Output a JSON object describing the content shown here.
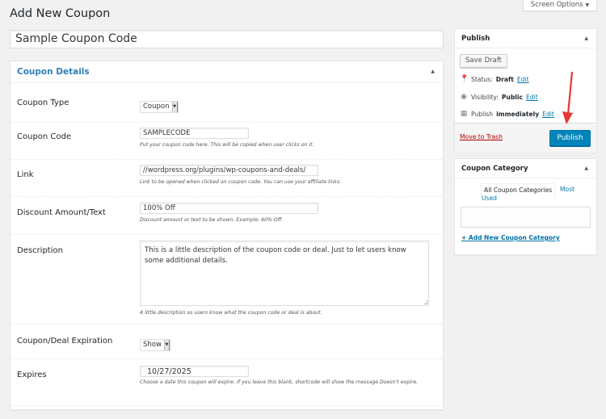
{
  "header": {
    "screen_options_label": "Screen Options",
    "page_title": "Add New Coupon"
  },
  "title_field": {
    "value": "Sample Coupon Code"
  },
  "coupon_details": {
    "title": "Coupon Details",
    "fields": {
      "coupon_type": {
        "label": "Coupon Type",
        "value": "Coupon"
      },
      "coupon_code": {
        "label": "Coupon Code",
        "value": "SAMPLECODE",
        "hint": "Put your coupon code here. This will be copied when user clicks on it."
      },
      "link": {
        "label": "Link",
        "value": "//wordpress.org/plugins/wp-coupons-and-deals/",
        "hint": "Link to be opened when clicked on coupon code. You can use your affiliate links."
      },
      "discount": {
        "label": "Discount Amount/Text",
        "value": "100% Off",
        "hint": "Discount amount or text to be shown. Example: 60% Off."
      },
      "description": {
        "label": "Description",
        "value": "This is a little description of the coupon code or deal. Just to let users know some additional details.",
        "hint": "A little description so users know what the coupon code or deal is about."
      },
      "expiration": {
        "label": "Coupon/Deal Expiration",
        "value": "Show"
      },
      "expires": {
        "label": "Expires",
        "value": "10/27/2025",
        "hint": "Choose a date this coupon will expire. If you leave this blank, shortcode will show the message Doesn't expire."
      }
    }
  },
  "publish": {
    "title": "Publish",
    "save_draft_label": "Save Draft",
    "status_label": "Status:",
    "status_value": "Draft",
    "visibility_label": "Visibility:",
    "visibility_value": "Public",
    "schedule_label": "Publish",
    "schedule_value": "immediately",
    "edit_label": "Edit",
    "trash_label": "Move to Trash",
    "publish_label": "Publish"
  },
  "category": {
    "title": "Coupon Category",
    "tab_all": "All Coupon Categories",
    "tab_most": "Most",
    "tab_used": "Used",
    "add_new_label": "+ Add New Coupon Category"
  },
  "colors": {
    "accent": "#0085ba",
    "link": "#0073aa",
    "trash": "#a00000",
    "arrow": "#e53935"
  }
}
